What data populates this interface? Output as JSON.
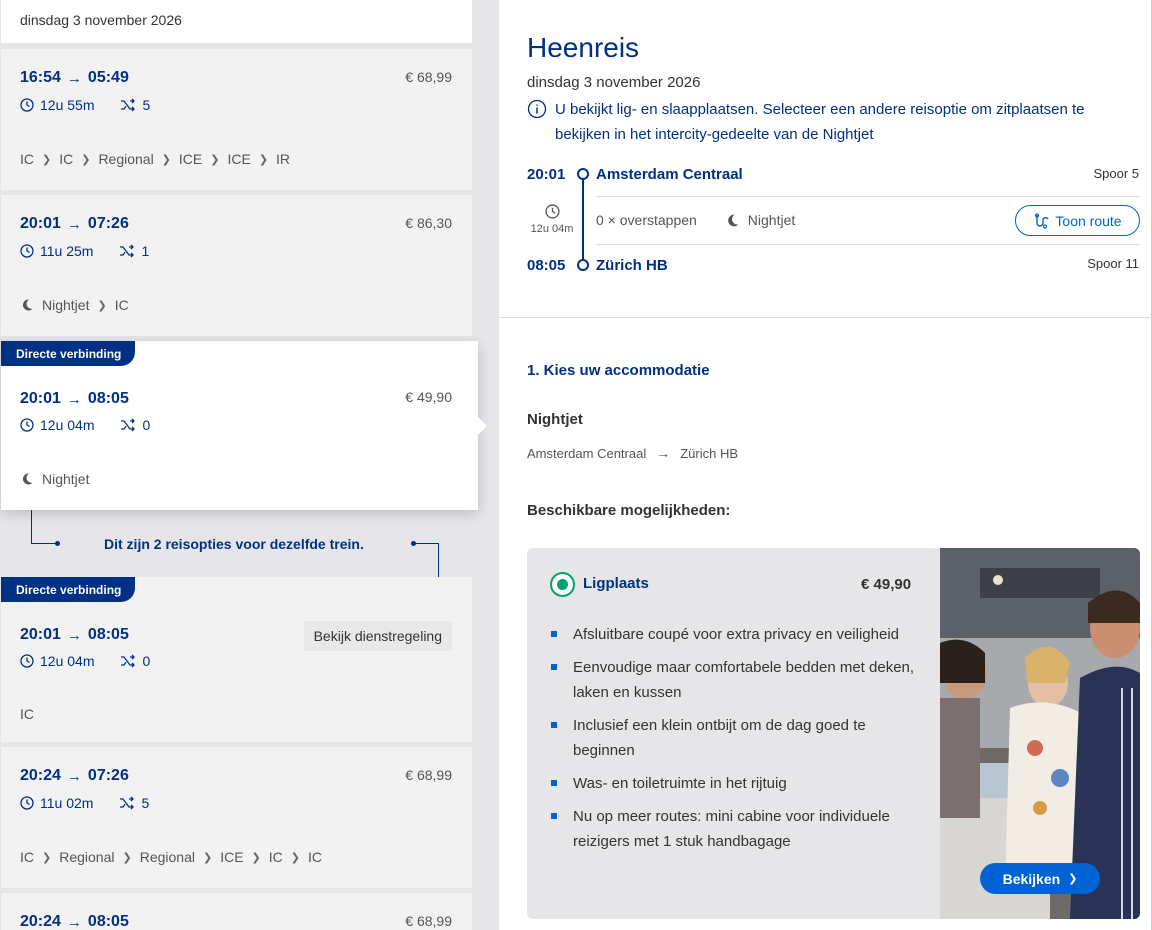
{
  "left": {
    "date": "dinsdag 3 november 2026",
    "badge_label": "Directe verbinding",
    "same_train_note": "Dit zijn 2 reisopties voor dezelfde trein.",
    "timetable_button": "Bekijk dienstregeling",
    "trips": [
      {
        "dep": "16:54",
        "arr": "05:49",
        "price": "€ 68,99",
        "duration": "12u 55m",
        "transfers": "5",
        "types": [
          "IC",
          "IC",
          "Regional",
          "ICE",
          "ICE",
          "IR"
        ]
      },
      {
        "dep": "20:01",
        "arr": "07:26",
        "price": "€ 86,30",
        "duration": "11u 25m",
        "transfers": "1",
        "types": [
          "Nightjet",
          "IC"
        ]
      },
      {
        "dep": "20:01",
        "arr": "08:05",
        "price": "€ 49,90",
        "duration": "12u 04m",
        "transfers": "0",
        "types": [
          "Nightjet"
        ]
      },
      {
        "dep": "20:01",
        "arr": "08:05",
        "duration": "12u 04m",
        "transfers": "0",
        "types": [
          "IC"
        ]
      },
      {
        "dep": "20:24",
        "arr": "07:26",
        "price": "€ 68,99",
        "duration": "11u 02m",
        "transfers": "5",
        "types": [
          "IC",
          "Regional",
          "Regional",
          "ICE",
          "IC",
          "IC"
        ]
      },
      {
        "dep": "20:24",
        "arr": "08:05",
        "price": "€ 68,99"
      }
    ]
  },
  "right": {
    "title": "Heenreis",
    "date": "dinsdag 3 november 2026",
    "info": "U bekijkt lig- en slaapplaatsen. Selecteer een andere reisoptie om zitplaatsen te bekijken in het intercity-gedeelte van de Nightjet",
    "departure": {
      "time": "20:01",
      "station": "Amsterdam Centraal",
      "platform": "Spoor 5"
    },
    "arrival": {
      "time": "08:05",
      "station": "Zürich HB",
      "platform": "Spoor 11"
    },
    "duration": "12u 04m",
    "transfers": "0 × overstappen",
    "train": "Nightjet",
    "route_button": "Toon route",
    "step_title": "1. Kies uw accommodatie",
    "section_train": "Nightjet",
    "route_from": "Amsterdam Centraal",
    "route_to": "Zürich HB",
    "available_title": "Beschikbare mogelijkheden:",
    "option": {
      "name": "Ligplaats",
      "price": "€ 49,90",
      "bullets": [
        "Afsluitbare coupé voor extra privacy en veiligheid",
        "Eenvoudige maar comfortabele bedden met deken, laken en kussen",
        "Inclusief een klein ontbijt om de dag goed te beginnen",
        "Was- en toiletruimte in het rijtuig",
        "Nu op meer routes: mini cabine voor individuele reizigers met 1 stuk handbagage"
      ],
      "view_button": "Bekijken"
    }
  },
  "colors": {
    "navy": "#003082",
    "blue": "#0063d3",
    "green": "#00a36c"
  }
}
